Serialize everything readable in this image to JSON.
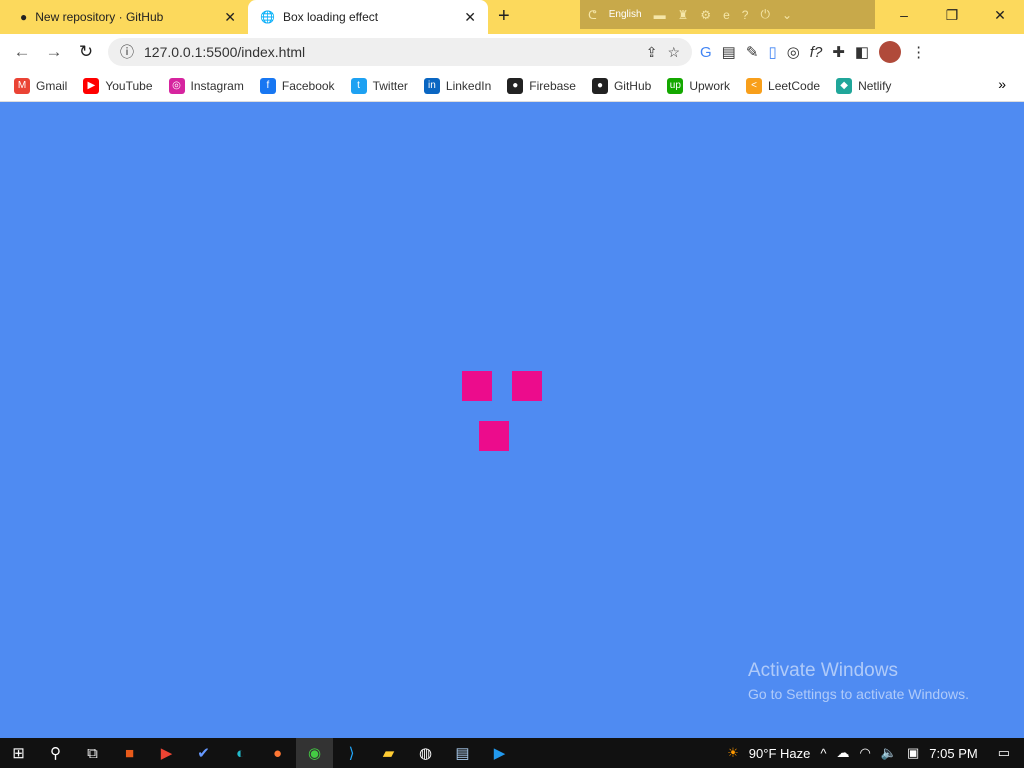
{
  "tabs": [
    {
      "title": "New repository · GitHub",
      "icon": "github-icon"
    },
    {
      "title": "Box loading effect",
      "icon": "globe-icon",
      "active": true
    }
  ],
  "extension_strip": {
    "language": "English"
  },
  "address": {
    "url": "127.0.0.1:5500/index.html"
  },
  "bookmarks": [
    {
      "label": "Gmail",
      "color": "#ea4335",
      "glyph": "M"
    },
    {
      "label": "YouTube",
      "color": "#ff0000",
      "glyph": "▶"
    },
    {
      "label": "Instagram",
      "color": "#d6249f",
      "glyph": "◎"
    },
    {
      "label": "Facebook",
      "color": "#1877f2",
      "glyph": "f"
    },
    {
      "label": "Twitter",
      "color": "#1da1f2",
      "glyph": "t"
    },
    {
      "label": "LinkedIn",
      "color": "#0a66c2",
      "glyph": "in"
    },
    {
      "label": "Firebase",
      "color": "#222222",
      "glyph": "●"
    },
    {
      "label": "GitHub",
      "color": "#222222",
      "glyph": "●"
    },
    {
      "label": "Upwork",
      "color": "#14a800",
      "glyph": "up"
    },
    {
      "label": "LeetCode",
      "color": "#f89f1b",
      "glyph": "<"
    },
    {
      "label": "Netlify",
      "color": "#20a69a",
      "glyph": "◆"
    }
  ],
  "page": {
    "box_color": "#ec0c8c",
    "background": "#4f8bf2"
  },
  "watermark": {
    "line1": "Activate Windows",
    "line2": "Go to Settings to activate Windows."
  },
  "taskbar": {
    "weather": "90°F  Haze",
    "time": "7:05 PM"
  }
}
